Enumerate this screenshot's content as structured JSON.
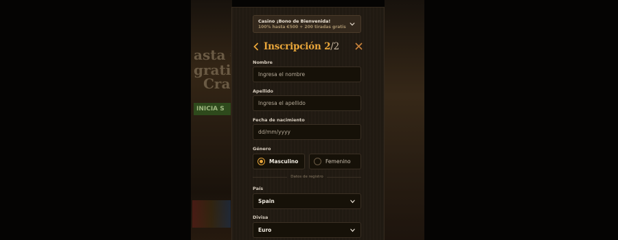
{
  "background": {
    "left_lines": [
      "asta €",
      "grati",
      "Cra"
    ],
    "button_label": "INICIA S"
  },
  "promo": {
    "title": "Casino ¡Bono de Bienvenida!",
    "subtitle": "100% hasta €500 + 200 tiradas gratis",
    "icon": "chevron-down-icon"
  },
  "header": {
    "title": "Inscripción 2",
    "step_suffix": "/2",
    "back_icon": "chevron-left-icon",
    "close_icon": "close-icon",
    "accent_color": "#e9a63a"
  },
  "form": {
    "nombre": {
      "label": "Nombre",
      "placeholder": "Ingresa el nombre"
    },
    "apellido": {
      "label": "Apellido",
      "placeholder": "Ingresa el apellido"
    },
    "fecha": {
      "label": "Fecha de nacimiento",
      "placeholder": "dd/mm/yyyy"
    },
    "genero": {
      "label": "Género",
      "options": [
        {
          "label": "Masculino",
          "selected": true
        },
        {
          "label": "Femenino",
          "selected": false
        }
      ]
    },
    "section_divider": "Datos de registro",
    "pais": {
      "label": "País",
      "value": "Spain"
    },
    "divisa": {
      "label": "Divisa",
      "value": "Euro"
    }
  }
}
